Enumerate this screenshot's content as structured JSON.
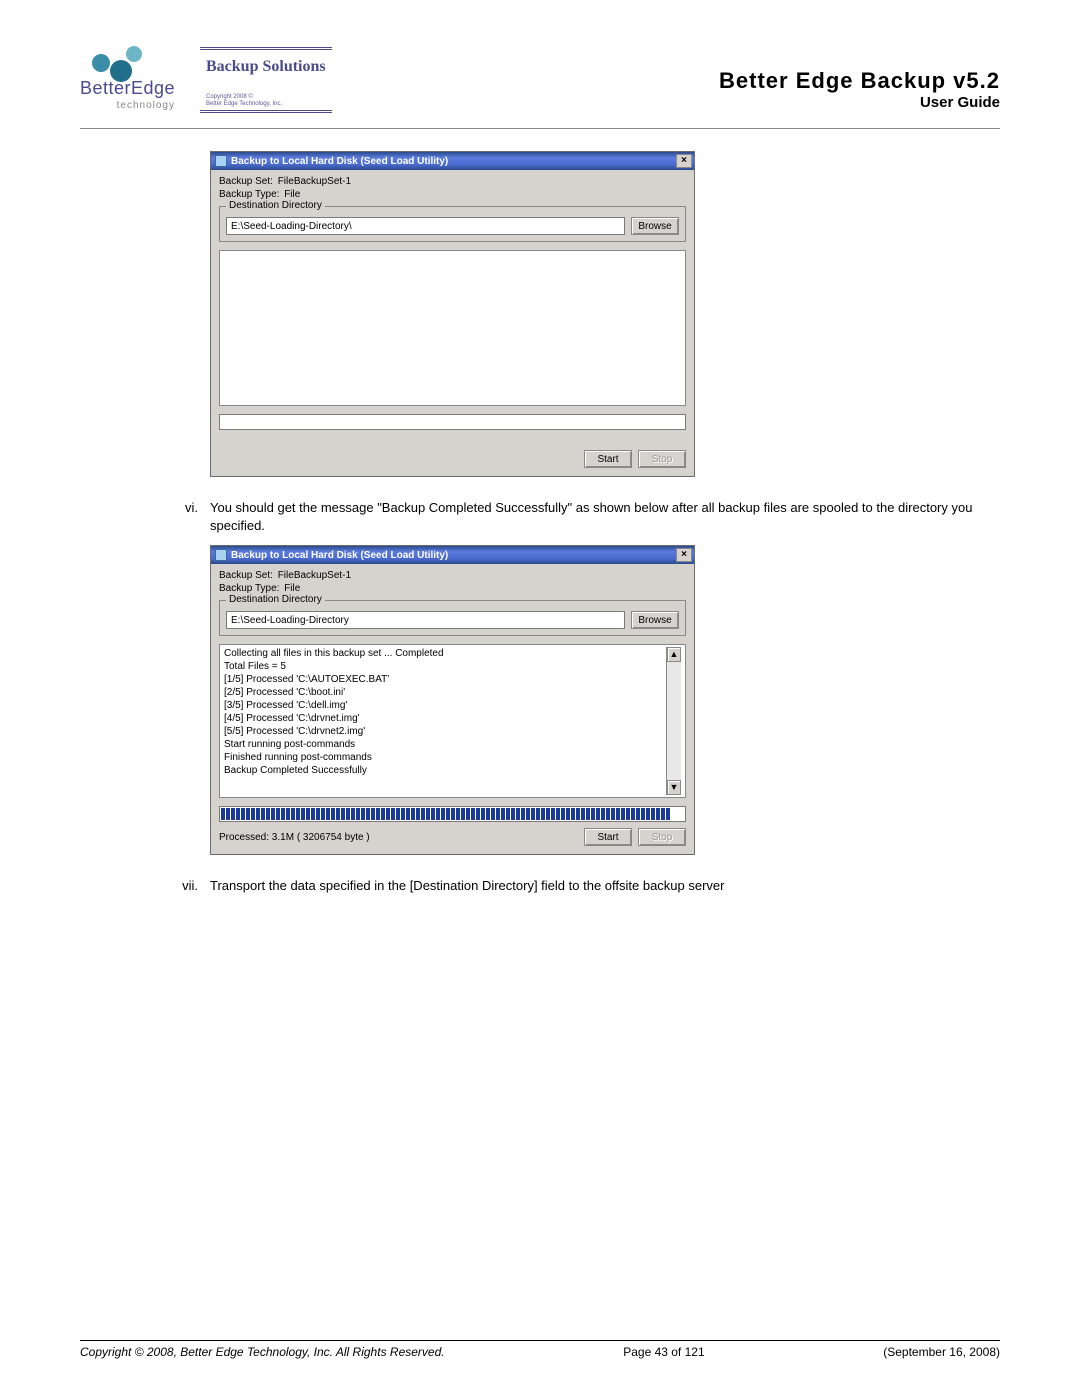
{
  "header": {
    "logo_text": "BetterEdge",
    "logo_sub": "technology",
    "bs_title": "Backup Solutions",
    "bs_copy1": "Copyright 2008 ©",
    "bs_copy2": "Better Edge Technology, Inc.",
    "title": "Better Edge Backup v5.2",
    "subtitle": "User Guide"
  },
  "win1": {
    "title": "Backup to Local Hard Disk (Seed Load Utility)",
    "set_label": "Backup Set:",
    "set_value": "FileBackupSet-1",
    "type_label": "Backup Type:",
    "type_value": "File",
    "dest_legend": "Destination Directory",
    "dest_value": "E:\\Seed-Loading-Directory\\",
    "browse": "Browse",
    "start": "Start",
    "stop": "Stop"
  },
  "step_vi": {
    "marker": "vi.",
    "text": "You should get the message \"Backup Completed Successfully\" as shown below after all backup files are spooled to the directory you specified."
  },
  "win2": {
    "title": "Backup to Local Hard Disk (Seed Load Utility)",
    "set_label": "Backup Set:",
    "set_value": "FileBackupSet-1",
    "type_label": "Backup Type:",
    "type_value": "File",
    "dest_legend": "Destination Directory",
    "dest_value": "E:\\Seed-Loading-Directory",
    "browse": "Browse",
    "log": [
      "Collecting all files in this backup set ... Completed",
      "Total Files = 5",
      "[1/5] Processed 'C:\\AUTOEXEC.BAT'",
      "[2/5] Processed 'C:\\boot.ini'",
      "[3/5] Processed 'C:\\dell.img'",
      "[4/5] Processed 'C:\\drvnet.img'",
      "[5/5] Processed 'C:\\drvnet2.img'",
      "Start running post-commands",
      "Finished running post-commands",
      "Backup Completed Successfully"
    ],
    "processed": "Processed: 3.1M ( 3206754 byte )",
    "start": "Start",
    "stop": "Stop"
  },
  "step_vii": {
    "marker": "vii.",
    "text": "Transport the data specified in the [Destination Directory] field to the offsite backup server"
  },
  "footer": {
    "copyright": "Copyright © 2008, Better Edge Technology, Inc.    All Rights Reserved.",
    "page": "Page 43 of 121",
    "date": "(September 16, 2008)"
  }
}
